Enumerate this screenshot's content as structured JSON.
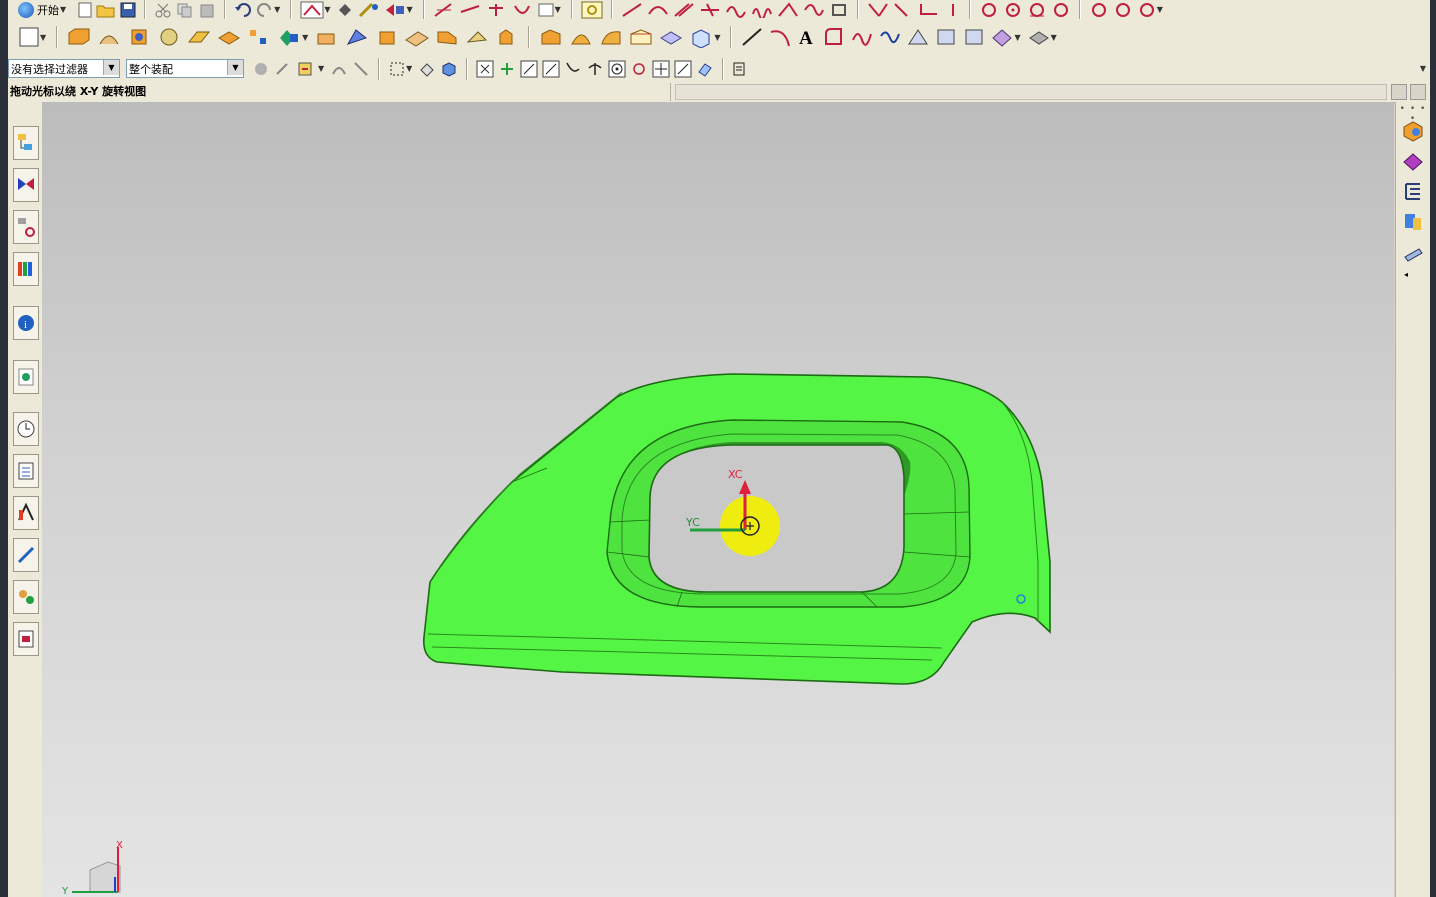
{
  "app": {
    "start_menu_label": "开始",
    "icons": [
      "nx-logo-icon",
      "new-file-icon",
      "open-folder-icon",
      "save-icon",
      "cut-icon",
      "copy-icon",
      "paste-icon",
      "undo-icon",
      "redo-icon"
    ]
  },
  "filters": {
    "selection_filter": "没有选择过滤器",
    "assembly_scope": "整个装配"
  },
  "status": {
    "prompt": "拖动光标以绕 X-Y 旋转视图"
  },
  "viewport": {
    "axis_labels": {
      "xc": "XC",
      "yc": "YC"
    },
    "triad_labels": {
      "x": "X",
      "y": "Y"
    },
    "colors": {
      "part_fill": "#55f545",
      "part_edge": "#1d6b14",
      "background_top": "#bcbcbc",
      "background_bottom": "#e4e4e4",
      "wcs_x": "#e0203a",
      "wcs_y": "#20a040",
      "rotate_cursor": "#f2f000"
    }
  },
  "resource_bar": {
    "buttons": [
      "assembly-navigator-icon",
      "constraint-navigator-icon",
      "part-navigator-icon",
      "reuse-library-icon",
      "web-browser-icon",
      "history-icon",
      "system-materials-icon",
      "process-studio-icon",
      "roles-icon",
      "manufacturing-wizard-icon",
      "hd3d-tools-icon",
      "palette-icon"
    ]
  },
  "right_panel": {
    "dots": "• • • •"
  }
}
